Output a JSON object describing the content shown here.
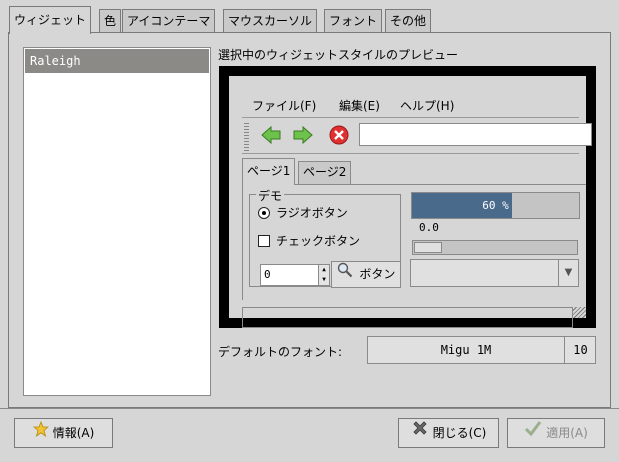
{
  "tabs": [
    "ウィジェット",
    "色",
    "アイコンテーマ",
    "マウスカーソル",
    "フォント",
    "その他"
  ],
  "theme_list": {
    "items": [
      "Raleigh"
    ]
  },
  "preview": {
    "title": "選択中のウィジェットスタイルのプレビュー",
    "menus": [
      "ファイル(F)",
      "編集(E)",
      "ヘルプ(H)"
    ],
    "tabs": [
      "ページ1",
      "ページ2"
    ],
    "frame_label": "デモ",
    "radio_label": "ラジオボタン",
    "check_label": "チェックボタン",
    "spin_value": "0",
    "button_label": "ボタン",
    "progress_text": "60 %",
    "progress_fraction": 0.6,
    "scale_value": "0.0"
  },
  "font": {
    "label": "デフォルトのフォント:",
    "name": "Migu 1M",
    "size": "10"
  },
  "buttons": {
    "info": "情報(A)",
    "close": "閉じる(C)",
    "apply": "適用(A)"
  }
}
